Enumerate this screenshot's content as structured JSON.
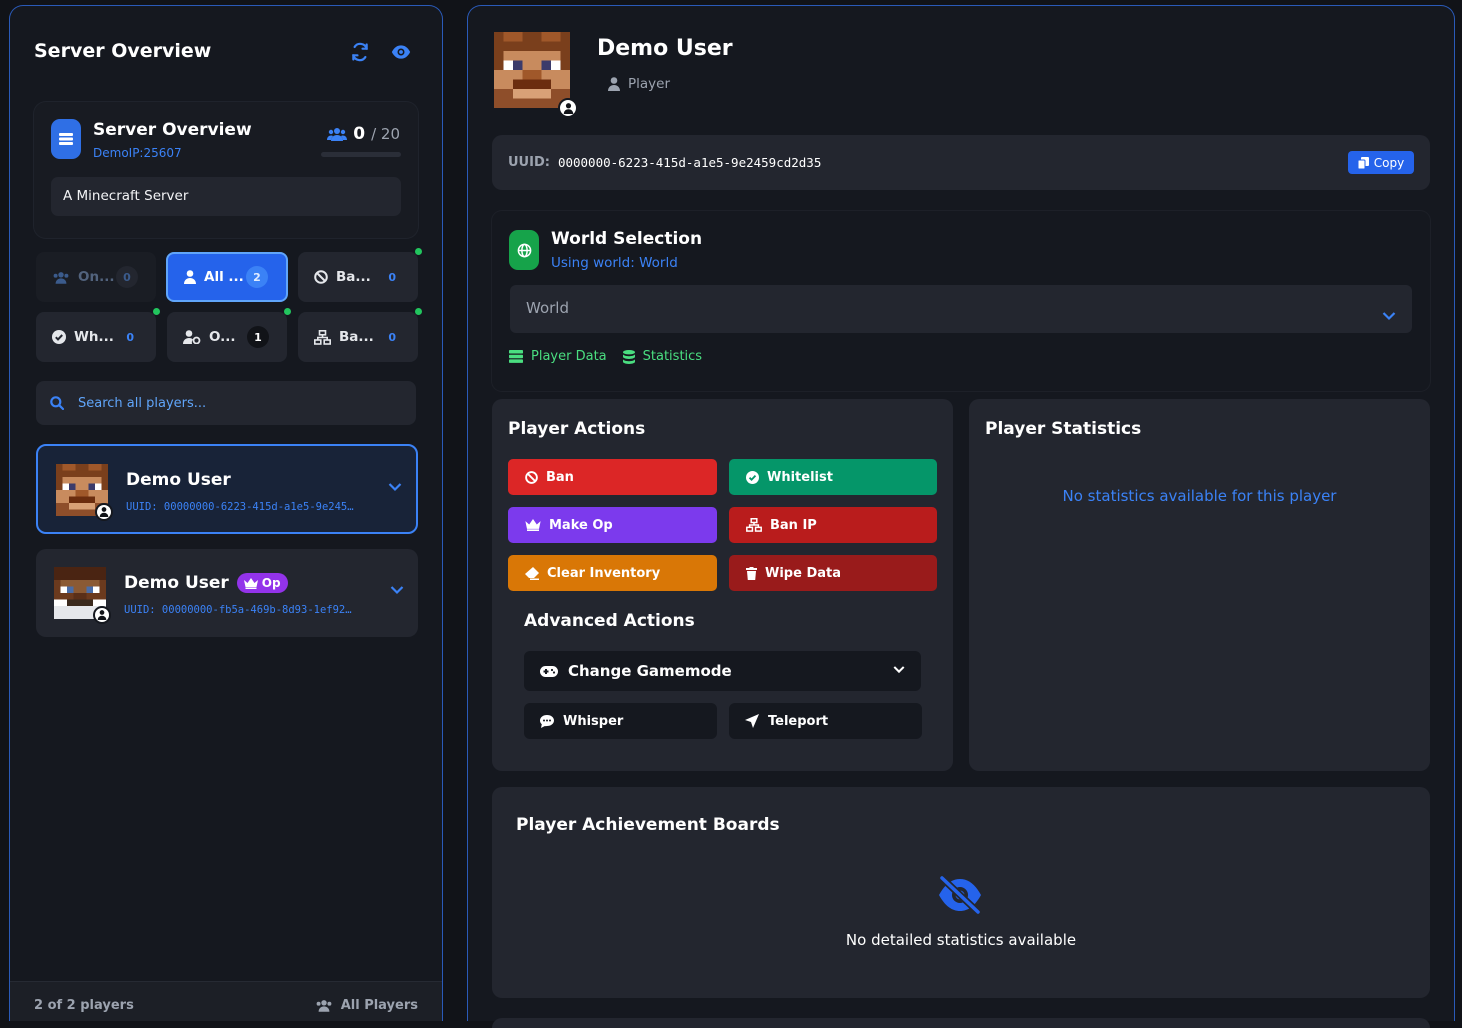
{
  "sidebar": {
    "title": "Server Overview",
    "refresh_icon": "refresh-icon",
    "view_icon": "eye-icon",
    "server": {
      "name": "Server Overview",
      "address": "DemoIP:25607",
      "online": "0",
      "max": "/ 20",
      "fill_fraction": 0,
      "motd": "A Minecraft Server"
    },
    "filters": [
      {
        "label": "On...",
        "count": "0",
        "icon": "users-icon"
      },
      {
        "label": "All ...",
        "count": "2",
        "icon": "user-icon"
      },
      {
        "label": "Ba...",
        "count": "0",
        "icon": "ban-icon"
      },
      {
        "label": "Wh...",
        "count": "0",
        "icon": "check-circle-icon"
      },
      {
        "label": "O...",
        "count": "1",
        "icon": "user-gear-icon"
      },
      {
        "label": "Ba...",
        "count": "0",
        "icon": "network-icon"
      }
    ],
    "search_placeholder": "Search all players...",
    "players": [
      {
        "name": "Demo User",
        "uuid": "UUID: 00000000-6223-415d-a1e5-9e245…",
        "badge": ""
      },
      {
        "name": "Demo User",
        "uuid": "UUID: 00000000-fb5a-469b-8d93-1ef92…",
        "badge": "Op"
      }
    ],
    "footer": {
      "count": "2 of 2 players",
      "filter": "All Players"
    }
  },
  "detail": {
    "name": "Demo User",
    "role": "Player",
    "uuid_label": "UUID:",
    "uuid": "0000000-6223-415d-a1e5-9e2459cd2d35",
    "copy_label": "Copy",
    "world": {
      "title": "World Selection",
      "subtitle": "Using world: World",
      "selected": "World",
      "links": [
        "Player Data",
        "Statistics"
      ]
    },
    "actions": {
      "title": "Player Actions",
      "buttons": [
        {
          "label": "Ban",
          "color": "#dc2626"
        },
        {
          "label": "Whitelist",
          "color": "#059669"
        },
        {
          "label": "Make Op",
          "color": "#7c3aed"
        },
        {
          "label": "Ban IP",
          "color": "#b91c1c"
        },
        {
          "label": "Clear Inventory",
          "color": "#d97706"
        },
        {
          "label": "Wipe Data",
          "color": "#991b1b"
        }
      ],
      "advanced_title": "Advanced Actions",
      "gamemode_label": "Change Gamemode",
      "whisper_label": "Whisper",
      "teleport_label": "Teleport"
    },
    "stats": {
      "title": "Player Statistics",
      "empty": "No statistics available for this player"
    },
    "boards": {
      "title": "Player Achievement Boards",
      "empty": "No detailed statistics available",
      "icon": "eye-slash-icon"
    }
  }
}
